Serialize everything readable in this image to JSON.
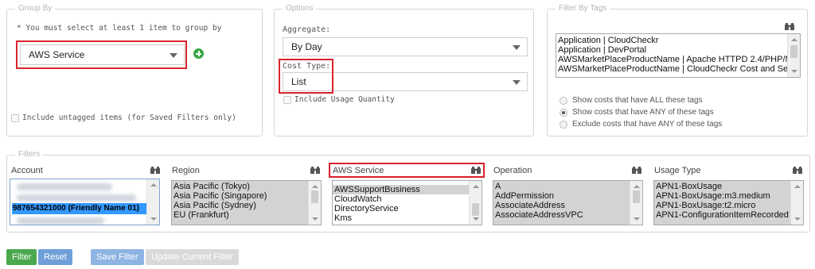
{
  "group_by": {
    "legend": "Group By",
    "hint": "* You must select at least 1 item to group by",
    "selected": "AWS Service",
    "untagged_label": "Include untagged items (for Saved Filters only)"
  },
  "options": {
    "legend": "Options",
    "aggregate_label": "Aggregate:",
    "aggregate_value": "By Day",
    "cost_type_label": "Cost Type:",
    "cost_type_value": "List",
    "usage_qty_label": "Include Usage Quantity"
  },
  "filter_by_tags": {
    "legend": "Filter By Tags",
    "tags": [
      "Application | CloudCheckr",
      "Application | DevPortal",
      "AWSMarketPlaceProductName | Apache HTTPD 2.4/PHP/M",
      "AWSMarketPlaceProductName | CloudCheckr Cost and Sec"
    ],
    "radio_all": "Show costs that have ALL these tags",
    "radio_any": "Show costs that have ANY of these tags",
    "radio_exclude": "Exclude costs that have ANY of these tags",
    "selected_radio": "any"
  },
  "filters": {
    "legend": "Filters",
    "account": {
      "title": "Account",
      "selected": "987654321000 (Friendly Name 01)"
    },
    "region": {
      "title": "Region",
      "items": [
        "Asia Pacific (Tokyo)",
        "Asia Pacific (Singapore)",
        "Asia Pacific (Sydney)",
        "EU (Frankfurt)"
      ]
    },
    "aws_service": {
      "title": "AWS Service",
      "items": [
        "AWSSupportBusiness",
        "CloudWatch",
        "DirectoryService",
        "Kms"
      ]
    },
    "operation": {
      "title": "Operation",
      "items": [
        "A",
        "AddPermission",
        "AssociateAddress",
        "AssociateAddressVPC"
      ]
    },
    "usage_type": {
      "title": "Usage Type",
      "items": [
        "APN1-BoxUsage",
        "APN1-BoxUsage:m3.medium",
        "APN1-BoxUsage:t2.micro",
        "APN1-ConfigurationItemRecorded"
      ]
    }
  },
  "buttons": {
    "filter": "Filter",
    "reset": "Reset",
    "save_filter": "Save Filter",
    "update_filter": "Update Current Filter"
  },
  "colors": {
    "highlight": "#d9232d",
    "add": "#3aa845",
    "filter_btn": "#4aa84f",
    "blue_btn": "#6f9fd8"
  }
}
